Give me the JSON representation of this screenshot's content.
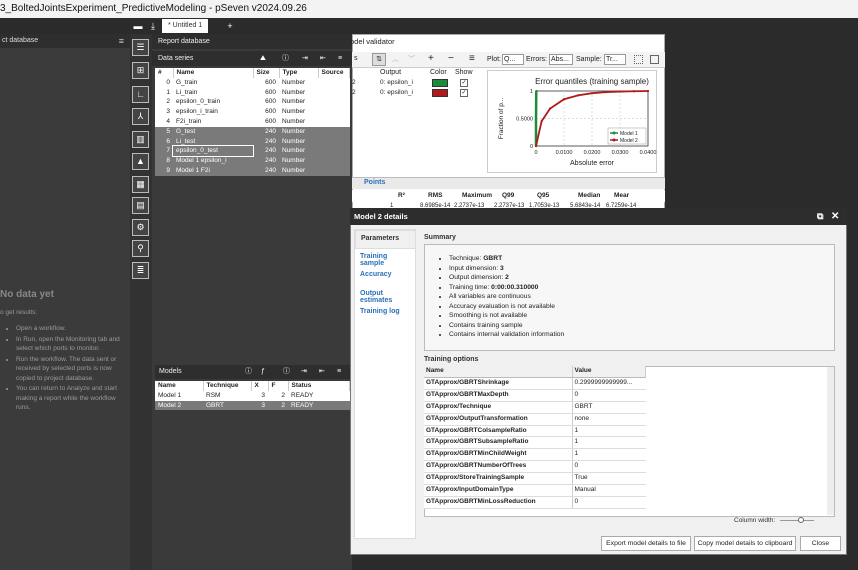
{
  "window": {
    "title": "3_BoltedJointsExperiment_PredictiveModeling - pSeven v2024.09.26"
  },
  "tabs": {
    "doc_tab": "* Untitled 1"
  },
  "left_panel": {
    "header": "ct database",
    "nodata_title": "No data yet",
    "nodata_sub": "o get results:",
    "steps": [
      "Open a workflow.",
      "In Run, open the Monitoring tab and select which ports to monitor.",
      "Run the workflow. The data sent or received by selected ports is now copied to project database.",
      "You can return to Analyze and start making a report while the workflow runs."
    ]
  },
  "report": {
    "title": "Report database",
    "data_series_label": "Data series",
    "columns": [
      "#",
      "Name",
      "Size",
      "Type",
      "Source"
    ],
    "rows": [
      {
        "id": "0",
        "name": "G_train",
        "size": "600",
        "type": "Number"
      },
      {
        "id": "1",
        "name": "Li_train",
        "size": "600",
        "type": "Number"
      },
      {
        "id": "2",
        "name": "epsilon_0_train",
        "size": "600",
        "type": "Number"
      },
      {
        "id": "3",
        "name": "epsilon_i_train",
        "size": "600",
        "type": "Number"
      },
      {
        "id": "4",
        "name": "F2i_train",
        "size": "600",
        "type": "Number"
      },
      {
        "id": "5",
        "name": "G_test",
        "size": "240",
        "type": "Number"
      },
      {
        "id": "6",
        "name": "Li_test",
        "size": "240",
        "type": "Number"
      },
      {
        "id": "7",
        "name": "epsilon_0_test",
        "size": "240",
        "type": "Number"
      },
      {
        "id": "8",
        "name": "Model 1 epsilon_i",
        "size": "240",
        "type": "Number"
      },
      {
        "id": "9",
        "name": "Model 1 F2i",
        "size": "240",
        "type": "Number"
      }
    ],
    "models_label": "Models",
    "model_columns": [
      "Name",
      "Technique",
      "X",
      "F",
      "Status"
    ],
    "models": [
      {
        "name": "Model 1",
        "technique": "RSM",
        "x": "3",
        "f": "2",
        "status": "READY"
      },
      {
        "name": "Model 2",
        "technique": "GBRT",
        "x": "3",
        "f": "2",
        "status": "READY"
      }
    ]
  },
  "validator": {
    "title": "odel validator",
    "plot_label": "Plot:",
    "plot_value": "Q...",
    "errors_label": "Errors:",
    "errors_value": "Abs...",
    "sample_label": "Sample:",
    "sample_value": "Tr...",
    "cols": [
      "Output",
      "Color",
      "Show"
    ],
    "rows": [
      {
        "output": "0: epsilon_i",
        "color": "#1e8a3c"
      },
      {
        "output": "0: epsilon_i",
        "color": "#b01a1a"
      }
    ],
    "points_tab": "Points",
    "stat_headers": [
      "R²",
      "RMS",
      "Maximum",
      "Q99",
      "Q95",
      "Median",
      "Mear"
    ],
    "stat_row": [
      "1",
      "8.6985e-14",
      "2.2737e-13",
      "2.2737e-13",
      "1.7053e-13",
      "5.6843e-14",
      "6.7259e-14"
    ]
  },
  "chart_data": {
    "type": "line",
    "title": "Error quantiles (training sample)",
    "xlabel": "Absolute error",
    "ylabel": "Fraction of p...",
    "xlim": [
      0,
      0.04
    ],
    "ylim": [
      0,
      1
    ],
    "x_ticks": [
      "0",
      "0.0100",
      "0.0200",
      "0.0300",
      "0.0400"
    ],
    "y_ticks": [
      "0",
      "0.5000",
      "1"
    ],
    "series": [
      {
        "name": "Model 1",
        "color": "#1e8a3c",
        "x": [
          0,
          0,
          0.0001,
          0.0002
        ],
        "y": [
          0,
          0.5,
          0.99,
          1
        ]
      },
      {
        "name": "Model 2",
        "color": "#b01a1a",
        "x": [
          0,
          0.002,
          0.005,
          0.01,
          0.015,
          0.02,
          0.025,
          0.03,
          0.035,
          0.04
        ],
        "y": [
          0,
          0.45,
          0.68,
          0.85,
          0.92,
          0.96,
          0.98,
          0.99,
          0.995,
          1
        ]
      }
    ],
    "legend": "bottom-right"
  },
  "dialog": {
    "title": "Model 2 details",
    "nav": [
      "Parameters",
      "Training sample",
      "Accuracy",
      "Output estimates",
      "Training log"
    ],
    "summary_label": "Summary",
    "summary": [
      {
        "k": "Technique: ",
        "v": "GBRT"
      },
      {
        "k": "Input dimension: ",
        "v": "3"
      },
      {
        "k": "Output dimension: ",
        "v": "2"
      },
      {
        "k": "Training time: ",
        "v": "0:00:00.310000"
      },
      {
        "k": "All variables are continuous",
        "v": ""
      },
      {
        "k": "Accuracy evaluation is not available",
        "v": ""
      },
      {
        "k": "Smoothing is not available",
        "v": ""
      },
      {
        "k": "Contains training sample",
        "v": ""
      },
      {
        "k": "Contains internal validation information",
        "v": ""
      }
    ],
    "options_label": "Training options",
    "opt_headers": [
      "Name",
      "Value"
    ],
    "options": [
      [
        "GTApprox/GBRTShrinkage",
        "0.2999999999999..."
      ],
      [
        "GTApprox/GBRTMaxDepth",
        "0"
      ],
      [
        "GTApprox/Technique",
        "GBRT"
      ],
      [
        "GTApprox/OutputTransformation",
        "none"
      ],
      [
        "GTApprox/GBRTColsampleRatio",
        "1"
      ],
      [
        "GTApprox/GBRTSubsampleRatio",
        "1"
      ],
      [
        "GTApprox/GBRTMinChildWeight",
        "1"
      ],
      [
        "GTApprox/GBRTNumberOfTrees",
        "0"
      ],
      [
        "GTApprox/StoreTrainingSample",
        "True"
      ],
      [
        "GTApprox/InputDomainType",
        "Manual"
      ],
      [
        "GTApprox/GBRTMinLossReduction",
        "0"
      ]
    ],
    "column_width_label": "Column width:",
    "buttons": {
      "export": "Export model details to file",
      "copy": "Copy model details to clipboard",
      "close": "Close"
    }
  }
}
